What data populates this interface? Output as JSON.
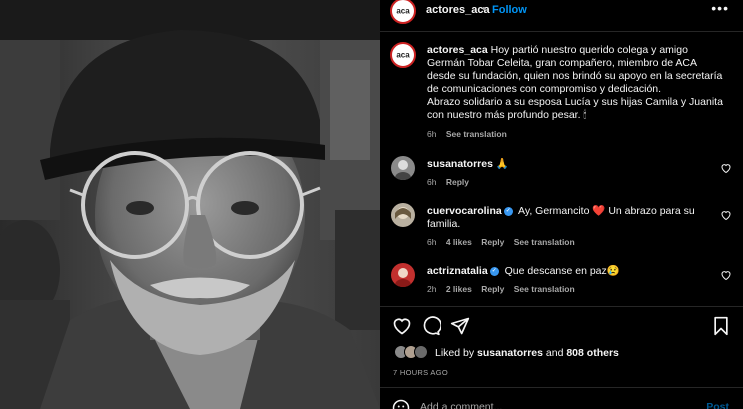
{
  "post": {
    "username": "actores_aca",
    "separator": "•",
    "follow_label": "Follow",
    "more_label": "•••",
    "avatar_text": "aca"
  },
  "caption": {
    "username": "actores_aca",
    "text": " Hoy partió nuestro querido colega y amigo Germán Tobar Celeita, gran compañero, miembro de ACA desde su fundación, quien nos brindó su apoyo en la secretaría de comunicaciones con compromiso y dedicación.",
    "text2": "Abrazo solidario a su esposa Lucía y sus hijas Camila y Juanita con nuestro más profundo pesar. 🕯",
    "time": "6h",
    "see_translation": "See translation"
  },
  "comments": [
    {
      "username": "susanatorres",
      "text": " 🙏",
      "verified": false,
      "time": "6h",
      "likes": "",
      "reply": "Reply",
      "see_translation": "",
      "avatar_color": "#8a8a8a"
    },
    {
      "username": "cuervocarolina",
      "text": " Ay, Germancito ❤️ Un abrazo para su familia.",
      "verified": true,
      "time": "6h",
      "likes": "4 likes",
      "reply": "Reply",
      "see_translation": "See translation",
      "avatar_color": "#b9b0a0"
    },
    {
      "username": "actriznatalia",
      "text": " Que descanse en paz😢",
      "verified": true,
      "time": "2h",
      "likes": "2 likes",
      "reply": "Reply",
      "see_translation": "See translation",
      "avatar_color": "#c2302e"
    }
  ],
  "likes": {
    "prefix": "Liked by ",
    "user": "susanatorres",
    "middle": " and ",
    "count": "808 others"
  },
  "time_ago": "7 HOURS AGO",
  "comment_box": {
    "placeholder": "Add a comment...",
    "post_label": "Post"
  },
  "colors": {
    "link": "#0095f6",
    "secondary_text": "#a8a8a8",
    "background": "#000000"
  }
}
